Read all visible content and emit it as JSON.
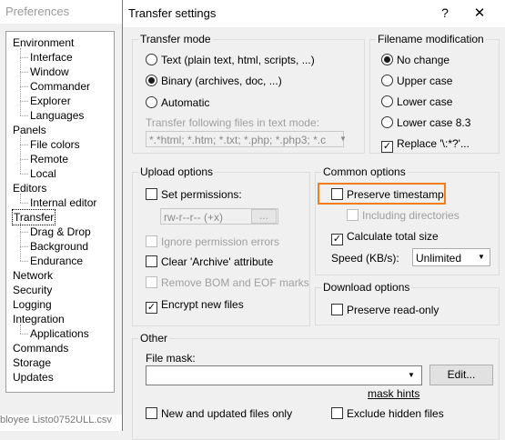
{
  "background": {
    "title": "Preferences",
    "bottom_text": "bloyee Listo0752ULL.csv"
  },
  "tree": [
    {
      "label": "Environment",
      "child": false
    },
    {
      "label": "Interface",
      "child": true
    },
    {
      "label": "Window",
      "child": true
    },
    {
      "label": "Commander",
      "child": true
    },
    {
      "label": "Explorer",
      "child": true
    },
    {
      "label": "Languages",
      "child": true
    },
    {
      "label": "Panels",
      "child": false
    },
    {
      "label": "File colors",
      "child": true
    },
    {
      "label": "Remote",
      "child": true
    },
    {
      "label": "Local",
      "child": true
    },
    {
      "label": "Editors",
      "child": false
    },
    {
      "label": "Internal editor",
      "child": true
    },
    {
      "label": "Transfer",
      "child": false,
      "selected": true
    },
    {
      "label": "Drag & Drop",
      "child": true
    },
    {
      "label": "Background",
      "child": true
    },
    {
      "label": "Endurance",
      "child": true
    },
    {
      "label": "Network",
      "child": false
    },
    {
      "label": "Security",
      "child": false
    },
    {
      "label": "Logging",
      "child": false
    },
    {
      "label": "Integration",
      "child": false
    },
    {
      "label": "Applications",
      "child": true
    },
    {
      "label": "Commands",
      "child": false
    },
    {
      "label": "Storage",
      "child": false
    },
    {
      "label": "Updates",
      "child": false
    }
  ],
  "dialog": {
    "title": "Transfer settings",
    "help": "?",
    "close": "✕"
  },
  "transfer_mode": {
    "label": "Transfer mode",
    "text": "Text (plain text, html, scripts, ...)",
    "binary": "Binary (archives, doc, ...)",
    "automatic": "Automatic",
    "files_label": "Transfer following files in text mode:",
    "files_value": "*.*html; *.htm; *.txt; *.php; *.php3; *.c",
    "selected": "binary"
  },
  "filename_mod": {
    "label": "Filename modification",
    "no_change": "No change",
    "upper": "Upper case",
    "lower": "Lower case",
    "lower83": "Lower case 8.3",
    "replace": "Replace '\\:*?'..."
  },
  "upload": {
    "label": "Upload options",
    "set_permissions": "Set permissions:",
    "permissions_value": "rw-r--r-- (+x)",
    "permissions_btn": "...",
    "ignore_perm": "Ignore permission errors",
    "clear_archive": "Clear 'Archive' attribute",
    "remove_bom": "Remove BOM and EOF marks",
    "encrypt": "Encrypt new files"
  },
  "common": {
    "label": "Common options",
    "preserve_timestamp": "Preserve timestamp",
    "including_dirs": "Including directories",
    "calc_total": "Calculate total size",
    "speed_label": "Speed (KB/s):",
    "speed_value": "Unlimited"
  },
  "download": {
    "label": "Download options",
    "preserve_readonly": "Preserve read-only"
  },
  "other": {
    "label": "Other",
    "file_mask_label": "File mask:",
    "file_mask_value": "",
    "edit_btn": "Edit...",
    "mask_hints": "mask hints",
    "new_updated": "New and updated files only",
    "exclude_hidden": "Exclude hidden files"
  }
}
